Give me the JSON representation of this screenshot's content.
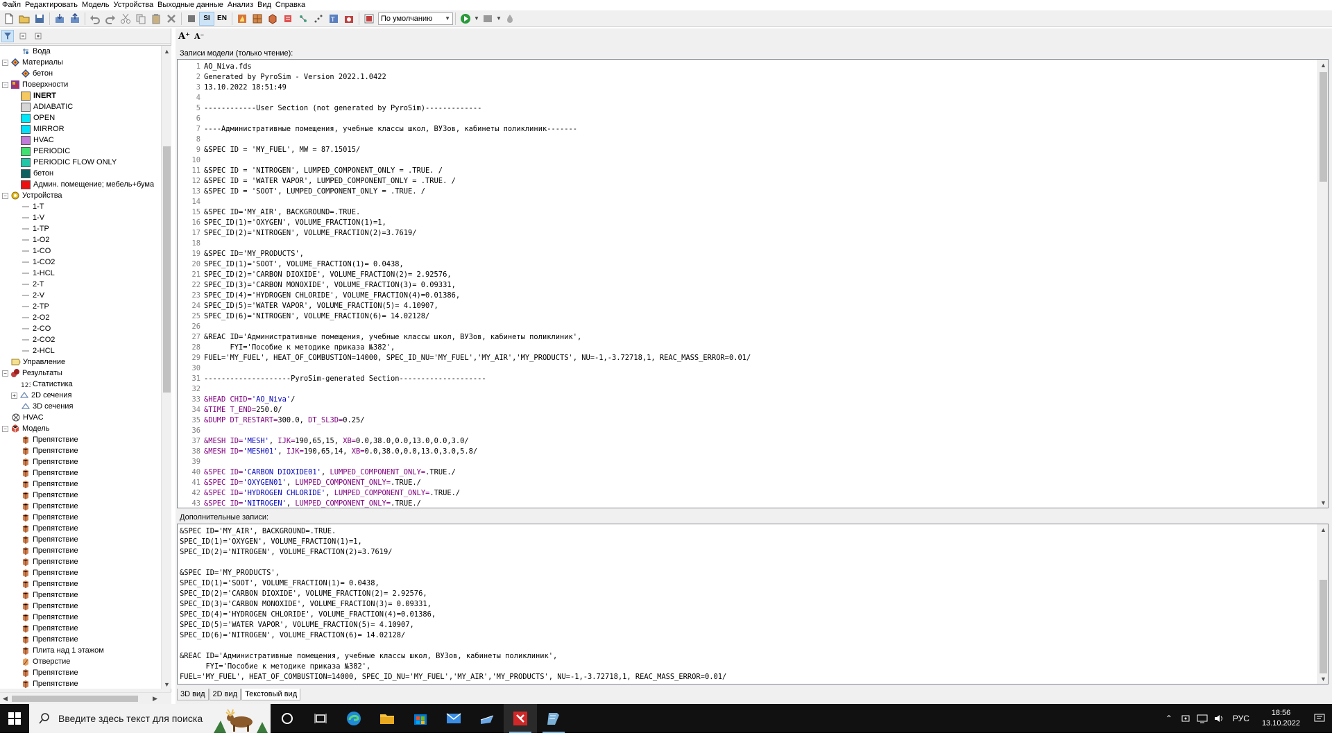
{
  "menu": [
    "Файл",
    "Редактировать",
    "Модель",
    "Устройства",
    "Выходные данные",
    "Анализ",
    "Вид",
    "Справка"
  ],
  "toolbar": {
    "si_label": "SI",
    "en_label": "EN",
    "profile_value": "По умолчанию"
  },
  "font_bar": {
    "increase": "A⁺",
    "decrease": "A⁻"
  },
  "tree": [
    {
      "label": "Вода",
      "indent": 2,
      "icon": "water-droplet-icon",
      "expander": ""
    },
    {
      "label": "Материалы",
      "indent": 0,
      "icon": "materials-icon",
      "expander": "−"
    },
    {
      "label": "бетон",
      "indent": 2,
      "icon": "material-item-icon",
      "expander": ""
    },
    {
      "label": "Поверхности",
      "indent": 0,
      "icon": "surfaces-icon",
      "expander": "−"
    },
    {
      "label": "INERT",
      "indent": 2,
      "swatch": "#f5c860",
      "bold": true,
      "expander": ""
    },
    {
      "label": "ADIABATIC",
      "indent": 2,
      "swatch": "#d6d6d6",
      "expander": ""
    },
    {
      "label": "OPEN",
      "indent": 2,
      "swatch": "#00e8f8",
      "expander": ""
    },
    {
      "label": "MIRROR",
      "indent": 2,
      "swatch": "#00e0f8",
      "expander": ""
    },
    {
      "label": "HVAC",
      "indent": 2,
      "swatch": "#c07cd8",
      "expander": ""
    },
    {
      "label": "PERIODIC",
      "indent": 2,
      "swatch": "#40e070",
      "expander": ""
    },
    {
      "label": "PERIODIC FLOW ONLY",
      "indent": 2,
      "swatch": "#20c8a8",
      "expander": ""
    },
    {
      "label": "бетон",
      "indent": 2,
      "swatch": "#0e6060",
      "expander": ""
    },
    {
      "label": "Админ. помещение; мебель+бума",
      "indent": 2,
      "swatch": "#ee1010",
      "expander": ""
    },
    {
      "label": "Устройства",
      "indent": 0,
      "icon": "devices-gear-icon",
      "expander": "−"
    },
    {
      "label": "1-T",
      "indent": 2,
      "icon": "device-line-icon",
      "expander": ""
    },
    {
      "label": "1-V",
      "indent": 2,
      "icon": "device-line-icon",
      "expander": ""
    },
    {
      "label": "1-TP",
      "indent": 2,
      "icon": "device-line-icon",
      "expander": ""
    },
    {
      "label": "1-O2",
      "indent": 2,
      "icon": "device-line-icon",
      "expander": ""
    },
    {
      "label": "1-CO",
      "indent": 2,
      "icon": "device-line-icon",
      "expander": ""
    },
    {
      "label": "1-CO2",
      "indent": 2,
      "icon": "device-line-icon",
      "expander": ""
    },
    {
      "label": "1-HCL",
      "indent": 2,
      "icon": "device-line-icon",
      "expander": ""
    },
    {
      "label": "2-T",
      "indent": 2,
      "icon": "device-line-icon",
      "expander": ""
    },
    {
      "label": "2-V",
      "indent": 2,
      "icon": "device-line-icon",
      "expander": ""
    },
    {
      "label": "2-TP",
      "indent": 2,
      "icon": "device-line-icon",
      "expander": ""
    },
    {
      "label": "2-O2",
      "indent": 2,
      "icon": "device-line-icon",
      "expander": ""
    },
    {
      "label": "2-CO",
      "indent": 2,
      "icon": "device-line-icon",
      "expander": ""
    },
    {
      "label": "2-CO2",
      "indent": 2,
      "icon": "device-line-icon",
      "expander": ""
    },
    {
      "label": "2-HCL",
      "indent": 2,
      "icon": "device-line-icon",
      "expander": ""
    },
    {
      "label": "Управление",
      "indent": 1,
      "icon": "control-icon",
      "expander": ""
    },
    {
      "label": "Результаты",
      "indent": 0,
      "icon": "results-icon",
      "expander": "−"
    },
    {
      "label": "Статистика",
      "indent": 2,
      "icon": "statistics-icon",
      "expander": ""
    },
    {
      "label": "2D сечения",
      "indent": 1,
      "icon": "slice-2d-icon",
      "expander": "+"
    },
    {
      "label": "3D сечения",
      "indent": 2,
      "icon": "slice-3d-icon",
      "expander": ""
    },
    {
      "label": "HVAC",
      "indent": 1,
      "icon": "hvac-icon",
      "expander": ""
    },
    {
      "label": "Модель",
      "indent": 0,
      "icon": "model-icon",
      "expander": "−"
    },
    {
      "label": "Препятствие",
      "indent": 2,
      "icon": "obstruction-icon",
      "expander": ""
    },
    {
      "label": "Препятствие",
      "indent": 2,
      "icon": "obstruction-icon",
      "expander": ""
    },
    {
      "label": "Препятствие",
      "indent": 2,
      "icon": "obstruction-icon",
      "expander": ""
    },
    {
      "label": "Препятствие",
      "indent": 2,
      "icon": "obstruction-icon",
      "expander": ""
    },
    {
      "label": "Препятствие",
      "indent": 2,
      "icon": "obstruction-icon",
      "expander": ""
    },
    {
      "label": "Препятствие",
      "indent": 2,
      "icon": "obstruction-icon",
      "expander": ""
    },
    {
      "label": "Препятствие",
      "indent": 2,
      "icon": "obstruction-icon",
      "expander": ""
    },
    {
      "label": "Препятствие",
      "indent": 2,
      "icon": "obstruction-icon",
      "expander": ""
    },
    {
      "label": "Препятствие",
      "indent": 2,
      "icon": "obstruction-icon",
      "expander": ""
    },
    {
      "label": "Препятствие",
      "indent": 2,
      "icon": "obstruction-icon",
      "expander": ""
    },
    {
      "label": "Препятствие",
      "indent": 2,
      "icon": "obstruction-icon",
      "expander": ""
    },
    {
      "label": "Препятствие",
      "indent": 2,
      "icon": "obstruction-icon",
      "expander": ""
    },
    {
      "label": "Препятствие",
      "indent": 2,
      "icon": "obstruction-icon",
      "expander": ""
    },
    {
      "label": "Препятствие",
      "indent": 2,
      "icon": "obstruction-icon",
      "expander": ""
    },
    {
      "label": "Препятствие",
      "indent": 2,
      "icon": "obstruction-icon",
      "expander": ""
    },
    {
      "label": "Препятствие",
      "indent": 2,
      "icon": "obstruction-icon",
      "expander": ""
    },
    {
      "label": "Препятствие",
      "indent": 2,
      "icon": "obstruction-icon",
      "expander": ""
    },
    {
      "label": "Препятствие",
      "indent": 2,
      "icon": "obstruction-icon",
      "expander": ""
    },
    {
      "label": "Препятствие",
      "indent": 2,
      "icon": "obstruction-icon",
      "expander": ""
    },
    {
      "label": "Плита над 1 этажом",
      "indent": 2,
      "icon": "obstruction-icon",
      "expander": ""
    },
    {
      "label": "Отверстие",
      "indent": 2,
      "icon": "hole-icon",
      "expander": ""
    },
    {
      "label": "Препятствие",
      "indent": 2,
      "icon": "obstruction-icon",
      "expander": ""
    },
    {
      "label": "Препятствие",
      "indent": 2,
      "icon": "obstruction-icon",
      "expander": ""
    }
  ],
  "records_pane": {
    "label": "Записи модели (только чтение):",
    "lines": [
      "AO_Niva.fds",
      "Generated by PyroSim - Version 2022.1.0422",
      "13.10.2022 18:51:49",
      "",
      "------------User Section (not generated by PyroSim)-------------",
      "",
      "----Административные помещения, учебные классы школ, ВУЗов, кабинеты поликлиник-------",
      "",
      "&SPEC ID = 'MY_FUEL', MW = 87.15015/",
      "",
      "&SPEC ID = 'NITROGEN', LUMPED_COMPONENT_ONLY = .TRUE. /",
      "&SPEC ID = 'WATER VAPOR', LUMPED_COMPONENT_ONLY = .TRUE. /",
      "&SPEC ID = 'SOOT', LUMPED_COMPONENT_ONLY = .TRUE. /",
      "",
      "&SPEC ID='MY_AIR', BACKGROUND=.TRUE.",
      "SPEC_ID(1)='OXYGEN', VOLUME_FRACTION(1)=1,",
      "SPEC_ID(2)='NITROGEN', VOLUME_FRACTION(2)=3.7619/",
      "",
      "&SPEC ID='MY_PRODUCTS',",
      "SPEC_ID(1)='SOOT', VOLUME_FRACTION(1)= 0.0438,",
      "SPEC_ID(2)='CARBON DIOXIDE', VOLUME_FRACTION(2)= 2.92576,",
      "SPEC_ID(3)='CARBON MONOXIDE', VOLUME_FRACTION(3)= 0.09331,",
      "SPEC_ID(4)='HYDROGEN CHLORIDE', VOLUME_FRACTION(4)=0.01386,",
      "SPEC_ID(5)='WATER VAPOR', VOLUME_FRACTION(5)= 4.10907,",
      "SPEC_ID(6)='NITROGEN', VOLUME_FRACTION(6)= 14.02128/",
      "",
      "&REAC ID='Административные помещения, учебные классы школ, ВУЗов, кабинеты поликлиник',",
      "      FYI='Пособие к методике приказа №382',",
      "FUEL='MY_FUEL', HEAT_OF_COMBUSTION=14000, SPEC_ID_NU='MY_FUEL','MY_AIR','MY_PRODUCTS', NU=-1,-3.72718,1, REAC_MASS_ERROR=0.01/",
      "",
      "--------------------PyroSim-generated Section--------------------",
      "",
      "&HEAD CHID='AO_Niva'/",
      "&TIME T_END=250.0/",
      "&DUMP DT_RESTART=300.0, DT_SL3D=0.25/",
      "",
      "&MESH ID='MESH', IJK=190,65,15, XB=0.0,38.0,0.0,13.0,0.0,3.0/",
      "&MESH ID='MESH01', IJK=190,65,14, XB=0.0,38.0,0.0,13.0,3.0,5.8/",
      "",
      "&SPEC ID='CARBON DIOXIDE01', LUMPED_COMPONENT_ONLY=.TRUE./",
      "&SPEC ID='OXYGEN01', LUMPED_COMPONENT_ONLY=.TRUE./",
      "&SPEC ID='HYDROGEN CHLORIDE', LUMPED_COMPONENT_ONLY=.TRUE./",
      "&SPEC ID='NITROGEN', LUMPED_COMPONENT_ONLY=.TRUE./"
    ]
  },
  "additional_pane": {
    "label": "Дополнительные записи:",
    "lines": [
      "&SPEC ID='MY_AIR', BACKGROUND=.TRUE.",
      "SPEC_ID(1)='OXYGEN', VOLUME_FRACTION(1)=1,",
      "SPEC_ID(2)='NITROGEN', VOLUME_FRACTION(2)=3.7619/",
      "",
      "&SPEC ID='MY_PRODUCTS',",
      "SPEC_ID(1)='SOOT', VOLUME_FRACTION(1)= 0.0438,",
      "SPEC_ID(2)='CARBON DIOXIDE', VOLUME_FRACTION(2)= 2.92576,",
      "SPEC_ID(3)='CARBON MONOXIDE', VOLUME_FRACTION(3)= 0.09331,",
      "SPEC_ID(4)='HYDROGEN CHLORIDE', VOLUME_FRACTION(4)=0.01386,",
      "SPEC_ID(5)='WATER VAPOR', VOLUME_FRACTION(5)= 4.10907,",
      "SPEC_ID(6)='NITROGEN', VOLUME_FRACTION(6)= 14.02128/",
      "",
      "&REAC ID='Административные помещения, учебные классы школ, ВУЗов, кабинеты поликлиник',",
      "      FYI='Пособие к методике приказа №382',",
      "FUEL='MY_FUEL', HEAT_OF_COMBUSTION=14000, SPEC_ID_NU='MY_FUEL','MY_AIR','MY_PRODUCTS', NU=-1,-3.72718,1, REAC_MASS_ERROR=0.01/"
    ]
  },
  "view_tabs": [
    "3D вид",
    "2D вид",
    "Текстовый вид"
  ],
  "active_view_tab": 2,
  "taskbar": {
    "search_placeholder": "Введите здесь текст для поиска",
    "lang": "РУС",
    "time": "18:56",
    "date": "13.10.2022"
  }
}
